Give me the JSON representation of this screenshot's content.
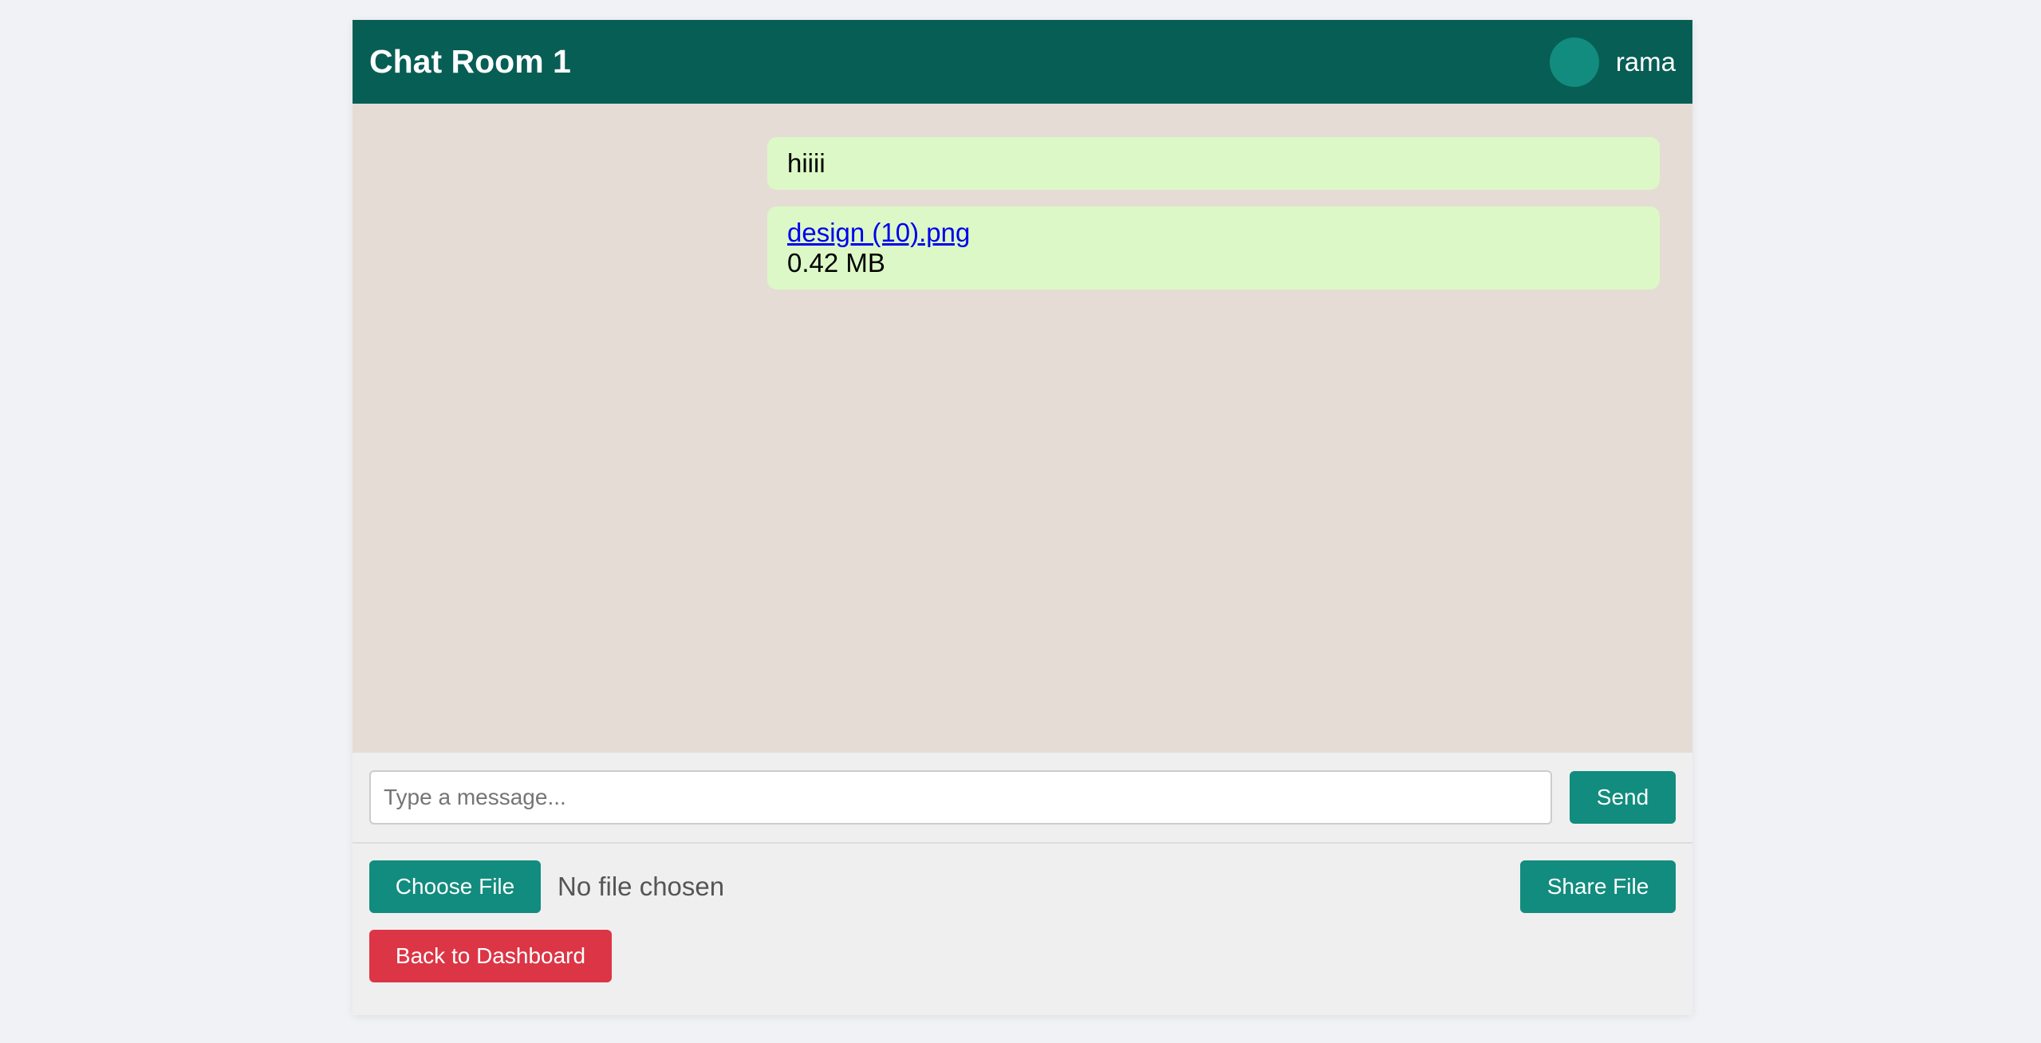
{
  "header": {
    "title": "Chat Room 1",
    "username": "rama"
  },
  "messages": [
    {
      "text": "hiiii"
    },
    {
      "file_name": "design (10).png",
      "file_size": "0.42 MB"
    }
  ],
  "composer": {
    "placeholder": "Type a message...",
    "value": "",
    "send_label": "Send"
  },
  "file_upload": {
    "choose_label": "Choose File",
    "status": "No file chosen",
    "share_label": "Share File"
  },
  "footer": {
    "back_label": "Back to Dashboard"
  },
  "colors": {
    "header_bg": "#075e54",
    "accent": "#128c7e",
    "message_bubble": "#dcf8c6",
    "chat_bg": "#e5ddd5",
    "danger": "#dc3545"
  }
}
